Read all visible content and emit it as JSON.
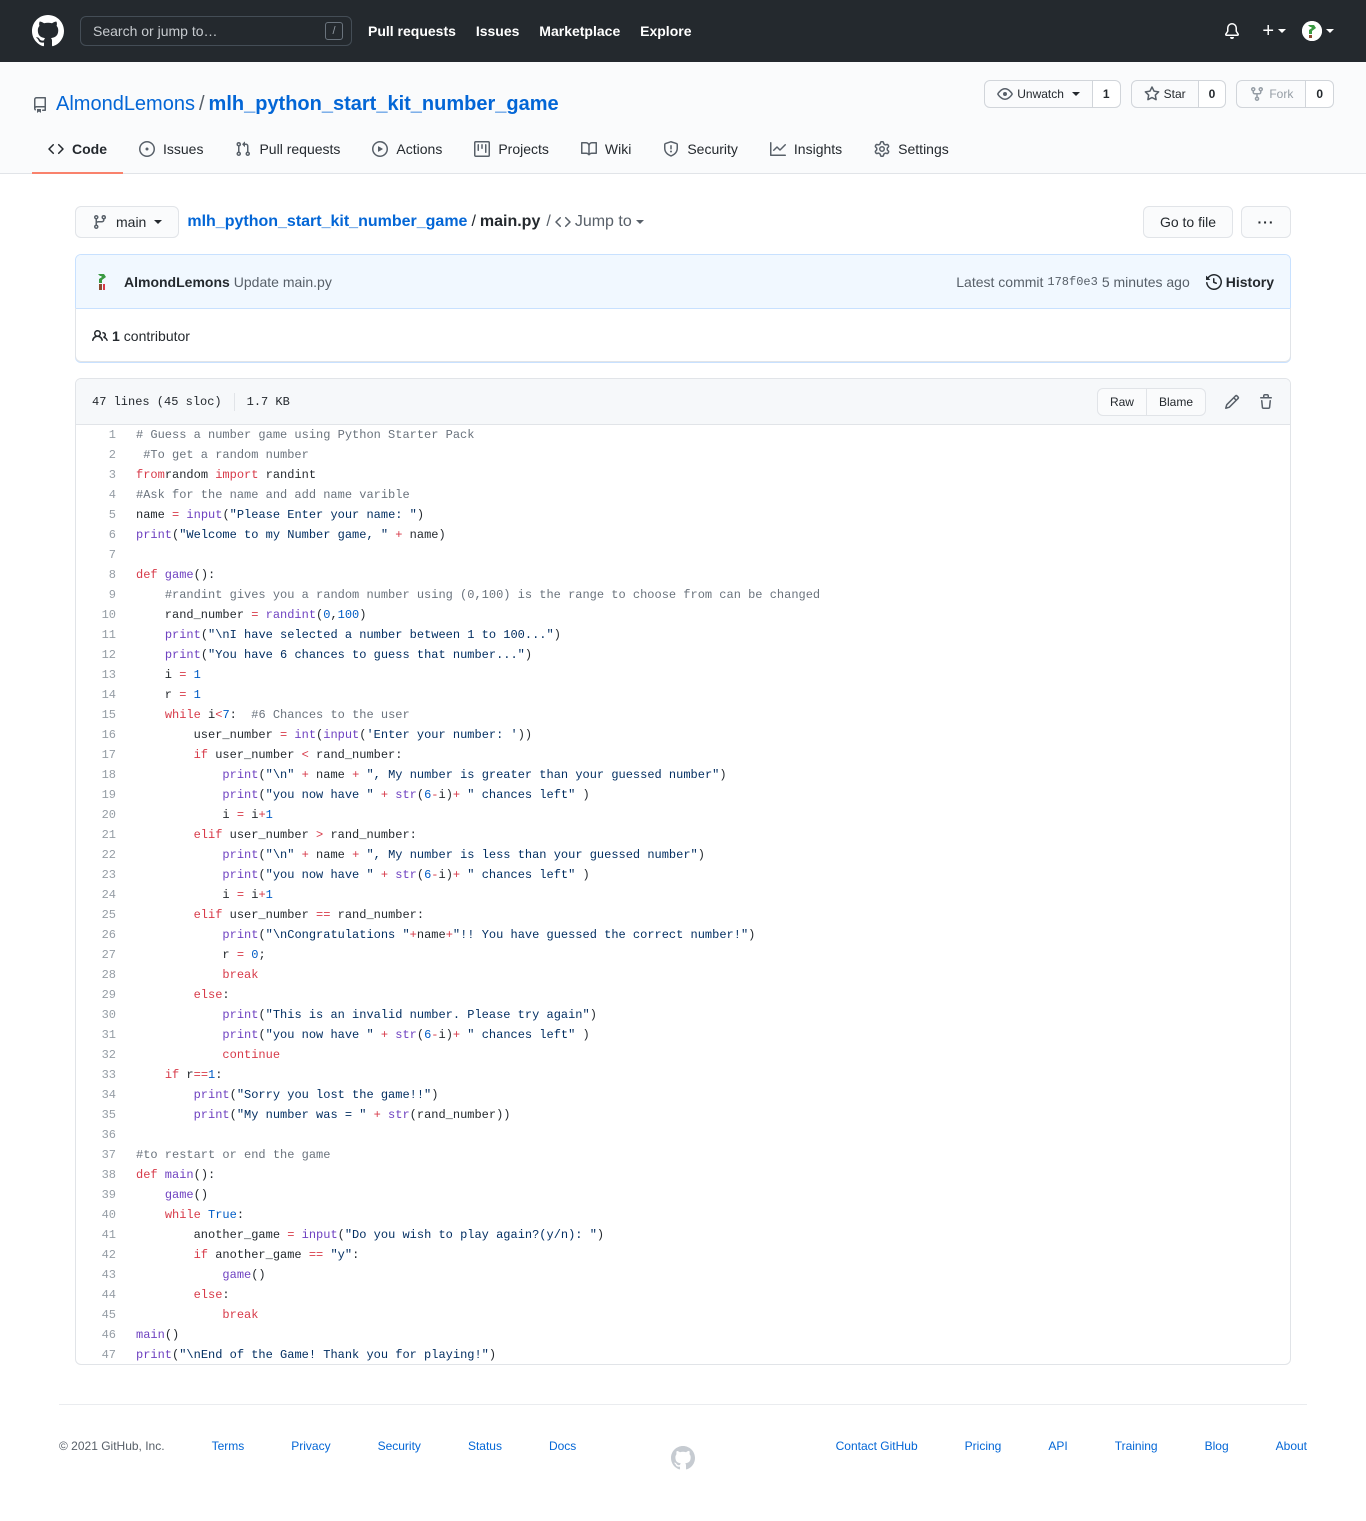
{
  "header": {
    "search_placeholder": "Search or jump to…",
    "search_shortcut": "/",
    "nav": [
      "Pull requests",
      "Issues",
      "Marketplace",
      "Explore"
    ],
    "plus": "+"
  },
  "repo": {
    "owner": "AlmondLemons",
    "separator": "/",
    "name": "mlh_python_start_kit_number_game",
    "watch_label": "Unwatch",
    "watch_count": "1",
    "star_label": "Star",
    "star_count": "0",
    "fork_label": "Fork",
    "fork_count": "0"
  },
  "tabs": [
    {
      "label": "Code",
      "icon": "code-icon"
    },
    {
      "label": "Issues",
      "icon": "issue-icon"
    },
    {
      "label": "Pull requests",
      "icon": "pull-request-icon"
    },
    {
      "label": "Actions",
      "icon": "play-icon"
    },
    {
      "label": "Projects",
      "icon": "project-icon"
    },
    {
      "label": "Wiki",
      "icon": "book-icon"
    },
    {
      "label": "Security",
      "icon": "shield-icon"
    },
    {
      "label": "Insights",
      "icon": "graph-icon"
    },
    {
      "label": "Settings",
      "icon": "gear-icon"
    }
  ],
  "filenav": {
    "branch": "main",
    "repo_link": "mlh_python_start_kit_number_game",
    "separator": "/",
    "file": "main.py",
    "jump_sep": "/",
    "jump_label": "Jump to",
    "goto_label": "Go to file",
    "more_label": "···"
  },
  "commit": {
    "author": "AlmondLemons",
    "message": "Update main.py",
    "latest_label": "Latest commit",
    "sha": "178f0e3",
    "time": "5 minutes ago",
    "history_label": "History",
    "contributors_count": "1",
    "contributors_label": "contributor"
  },
  "blob": {
    "lines_info": "47 lines (45 sloc)",
    "size": "1.7 KB",
    "raw_label": "Raw",
    "blame_label": "Blame"
  },
  "code_lines": [
    [
      [
        "c",
        "# Guess a number game using Python Starter Pack"
      ]
    ],
    [
      [
        "c",
        " #To get a random number"
      ]
    ],
    [
      [
        "k",
        "from"
      ],
      [
        "",
        "random "
      ],
      [
        "k",
        "import"
      ],
      [
        "",
        " randint"
      ]
    ],
    [
      [
        "c",
        "#Ask for the name and add name varible"
      ]
    ],
    [
      [
        "",
        "name "
      ],
      [
        "k",
        "="
      ],
      [
        " ",
        ""
      ],
      [
        "f",
        " input"
      ],
      [
        "",
        "("
      ],
      [
        "s",
        "\"Please Enter your name: \""
      ],
      [
        "",
        ")"
      ]
    ],
    [
      [
        "f",
        "print"
      ],
      [
        "",
        "("
      ],
      [
        "s",
        "\"Welcome to my Number game, \""
      ],
      [
        "k",
        " +"
      ],
      [
        "",
        " name)"
      ]
    ],
    [],
    [
      [
        "k",
        "def"
      ],
      [
        "f",
        " game"
      ],
      [
        "",
        "():"
      ]
    ],
    [
      [
        "",
        "    "
      ],
      [
        "c",
        "#randint gives you a random number using (0,100) is the range to choose from can be changed"
      ]
    ],
    [
      [
        "",
        "    rand_number "
      ],
      [
        "k",
        "="
      ],
      [
        "f",
        " randint"
      ],
      [
        "",
        "("
      ],
      [
        "n",
        "0"
      ],
      [
        "",
        ","
      ],
      [
        "n",
        "100"
      ],
      [
        "",
        ")"
      ]
    ],
    [
      [
        "",
        "    "
      ],
      [
        "f",
        "print"
      ],
      [
        "",
        "("
      ],
      [
        "s",
        "\"\\nI have selected a number between 1 to 100...\""
      ],
      [
        "",
        ")"
      ]
    ],
    [
      [
        "",
        "    "
      ],
      [
        "f",
        "print"
      ],
      [
        "",
        "("
      ],
      [
        "s",
        "\"You have 6 chances to guess that number...\""
      ],
      [
        "",
        ")"
      ]
    ],
    [
      [
        "",
        "    i "
      ],
      [
        "k",
        "="
      ],
      [
        "n",
        " 1"
      ]
    ],
    [
      [
        "",
        "    r "
      ],
      [
        "k",
        "="
      ],
      [
        "n",
        " 1"
      ]
    ],
    [
      [
        "",
        "    "
      ],
      [
        "k",
        "while"
      ],
      [
        "",
        " i"
      ],
      [
        "k",
        "<"
      ],
      [
        "n",
        "7"
      ],
      [
        "",
        ":  "
      ],
      [
        "c",
        "#6 Chances to the user"
      ]
    ],
    [
      [
        "",
        "        user_number "
      ],
      [
        "k",
        "="
      ],
      [
        "f",
        " int"
      ],
      [
        "",
        "("
      ],
      [
        "f",
        "input"
      ],
      [
        "",
        "("
      ],
      [
        "s",
        "'Enter your number: '"
      ],
      [
        "",
        "))"
      ]
    ],
    [
      [
        "",
        "        "
      ],
      [
        "k",
        "if"
      ],
      [
        "",
        " user_number "
      ],
      [
        "k",
        "<"
      ],
      [
        "",
        " rand_number:"
      ]
    ],
    [
      [
        "",
        "            "
      ],
      [
        "f",
        "print"
      ],
      [
        "",
        "("
      ],
      [
        "s",
        "\"\\n\""
      ],
      [
        "k",
        " +"
      ],
      [
        "",
        " name "
      ],
      [
        "k",
        "+"
      ],
      [
        "s",
        " \", My number is greater than your guessed number\""
      ],
      [
        "",
        ")"
      ]
    ],
    [
      [
        "",
        "            "
      ],
      [
        "f",
        "print"
      ],
      [
        "",
        "("
      ],
      [
        "s",
        "\"you now have \""
      ],
      [
        "k",
        " +"
      ],
      [
        "f",
        " str"
      ],
      [
        "",
        "("
      ],
      [
        "n",
        "6"
      ],
      [
        "k",
        "-"
      ],
      [
        "",
        "i)"
      ],
      [
        "k",
        "+"
      ],
      [
        "s",
        " \" chances left\""
      ],
      [
        "",
        " )"
      ]
    ],
    [
      [
        "",
        "            i "
      ],
      [
        "k",
        "="
      ],
      [
        "",
        " i"
      ],
      [
        "k",
        "+"
      ],
      [
        "n",
        "1"
      ]
    ],
    [
      [
        "",
        "        "
      ],
      [
        "k",
        "elif"
      ],
      [
        "",
        " user_number "
      ],
      [
        "k",
        ">"
      ],
      [
        "",
        " rand_number:"
      ]
    ],
    [
      [
        "",
        "            "
      ],
      [
        "f",
        "print"
      ],
      [
        "",
        "("
      ],
      [
        "s",
        "\"\\n\""
      ],
      [
        "k",
        " +"
      ],
      [
        "",
        " name "
      ],
      [
        "k",
        "+"
      ],
      [
        "s",
        " \", My number is less than your guessed number\""
      ],
      [
        "",
        ")"
      ]
    ],
    [
      [
        "",
        "            "
      ],
      [
        "f",
        "print"
      ],
      [
        "",
        "("
      ],
      [
        "s",
        "\"you now have \""
      ],
      [
        "k",
        " +"
      ],
      [
        "f",
        " str"
      ],
      [
        "",
        "("
      ],
      [
        "n",
        "6"
      ],
      [
        "k",
        "-"
      ],
      [
        "",
        "i)"
      ],
      [
        "k",
        "+"
      ],
      [
        "s",
        " \" chances left\""
      ],
      [
        "",
        " )"
      ]
    ],
    [
      [
        "",
        "            i "
      ],
      [
        "k",
        "="
      ],
      [
        "",
        " i"
      ],
      [
        "k",
        "+"
      ],
      [
        "n",
        "1"
      ]
    ],
    [
      [
        "",
        "        "
      ],
      [
        "k",
        "elif"
      ],
      [
        "",
        " user_number "
      ],
      [
        "k",
        "=="
      ],
      [
        "",
        " rand_number:"
      ]
    ],
    [
      [
        "",
        "            "
      ],
      [
        "f",
        "print"
      ],
      [
        "",
        "("
      ],
      [
        "s",
        "\"\\nCongratulations \""
      ],
      [
        "k",
        "+"
      ],
      [
        "",
        "name"
      ],
      [
        "k",
        "+"
      ],
      [
        "s",
        "\"!! You have guessed the correct number!\""
      ],
      [
        "",
        ")"
      ]
    ],
    [
      [
        "",
        "            r "
      ],
      [
        "k",
        "="
      ],
      [
        "n",
        " 0"
      ],
      [
        "",
        ";"
      ]
    ],
    [
      [
        "",
        "            "
      ],
      [
        "k",
        "break"
      ]
    ],
    [
      [
        "",
        "        "
      ],
      [
        "k",
        "else"
      ],
      [
        "",
        ":"
      ]
    ],
    [
      [
        "",
        "            "
      ],
      [
        "f",
        "print"
      ],
      [
        "",
        "("
      ],
      [
        "s",
        "\"This is an invalid number. Please try again\""
      ],
      [
        "",
        ")"
      ]
    ],
    [
      [
        "",
        "            "
      ],
      [
        "f",
        "print"
      ],
      [
        "",
        "("
      ],
      [
        "s",
        "\"you now have \""
      ],
      [
        "k",
        " +"
      ],
      [
        "f",
        " str"
      ],
      [
        "",
        "("
      ],
      [
        "n",
        "6"
      ],
      [
        "k",
        "-"
      ],
      [
        "",
        "i)"
      ],
      [
        "k",
        "+"
      ],
      [
        "s",
        " \" chances left\""
      ],
      [
        "",
        " )"
      ]
    ],
    [
      [
        "",
        "            "
      ],
      [
        "k",
        "continue"
      ]
    ],
    [
      [
        "",
        "    "
      ],
      [
        "k",
        "if"
      ],
      [
        "",
        " r"
      ],
      [
        "k",
        "=="
      ],
      [
        "n",
        "1"
      ],
      [
        "",
        ":"
      ]
    ],
    [
      [
        "",
        "        "
      ],
      [
        "f",
        "print"
      ],
      [
        "",
        "("
      ],
      [
        "s",
        "\"Sorry you lost the game!!\""
      ],
      [
        "",
        ")"
      ]
    ],
    [
      [
        "",
        "        "
      ],
      [
        "f",
        "print"
      ],
      [
        "",
        "("
      ],
      [
        "s",
        "\"My number was = \""
      ],
      [
        "k",
        " +"
      ],
      [
        "f",
        " str"
      ],
      [
        "",
        "(rand_number))"
      ]
    ],
    [],
    [
      [
        "c",
        "#to restart or end the game"
      ]
    ],
    [
      [
        "k",
        "def"
      ],
      [
        "f",
        " main"
      ],
      [
        "",
        "():"
      ]
    ],
    [
      [
        "",
        "    "
      ],
      [
        "f",
        "game"
      ],
      [
        "",
        "()"
      ]
    ],
    [
      [
        "",
        "    "
      ],
      [
        "k",
        "while"
      ],
      [
        "n",
        " True"
      ],
      [
        "",
        ":"
      ]
    ],
    [
      [
        "",
        "        another_game "
      ],
      [
        "k",
        "="
      ],
      [
        "f",
        " input"
      ],
      [
        "",
        "("
      ],
      [
        "s",
        "\"Do you wish to play again?(y/n): \""
      ],
      [
        "",
        ")"
      ]
    ],
    [
      [
        "",
        "        "
      ],
      [
        "k",
        "if"
      ],
      [
        "",
        " another_game "
      ],
      [
        "k",
        "=="
      ],
      [
        "s",
        " \"y\""
      ],
      [
        "",
        ":"
      ]
    ],
    [
      [
        "",
        "            "
      ],
      [
        "f",
        "game"
      ],
      [
        "",
        "()"
      ]
    ],
    [
      [
        "",
        "        "
      ],
      [
        "k",
        "else"
      ],
      [
        "",
        ":"
      ]
    ],
    [
      [
        "",
        "            "
      ],
      [
        "k",
        "break"
      ]
    ],
    [
      [
        "f",
        "main"
      ],
      [
        "",
        "()"
      ]
    ],
    [
      [
        "f",
        "print"
      ],
      [
        "",
        "("
      ],
      [
        "s",
        "\"\\nEnd of the Game! Thank you for playing!\""
      ],
      [
        "",
        ")"
      ]
    ]
  ],
  "footer": {
    "copyright": "© 2021 GitHub, Inc.",
    "left_links": [
      "Terms",
      "Privacy",
      "Security",
      "Status",
      "Docs"
    ],
    "right_links": [
      "Contact GitHub",
      "Pricing",
      "API",
      "Training",
      "Blog",
      "About"
    ]
  },
  "colors": {
    "header_bg": "#24292e",
    "link": "#0366d6",
    "tab_underline": "#f9826c",
    "keyword": "#d73a49",
    "function": "#6f42c1",
    "string": "#032f62",
    "comment": "#6a737d",
    "number": "#005cc5"
  }
}
